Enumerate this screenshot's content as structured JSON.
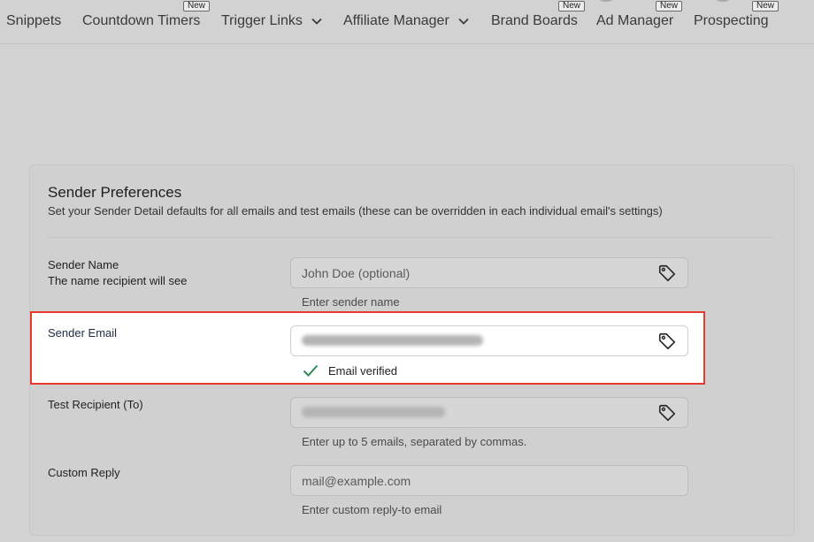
{
  "nav": {
    "items": [
      {
        "label": "Snippets"
      },
      {
        "label": "Countdown Timers",
        "badge": "New"
      },
      {
        "label": "Trigger Links"
      },
      {
        "label": "Affiliate Manager"
      },
      {
        "label": "Brand Boards",
        "badge": "New"
      },
      {
        "label": "Ad Manager",
        "badge": "New"
      },
      {
        "label": "Prospecting",
        "badge": "New"
      }
    ]
  },
  "sender_preferences": {
    "title": "Sender Preferences",
    "subtitle": "Set your Sender Detail defaults for all emails and test emails (these can be overridden in each individual email's settings)",
    "sender_name": {
      "label": "Sender Name",
      "description": "The name recipient will see",
      "placeholder": "John Doe (optional)",
      "helper": "Enter sender name"
    },
    "sender_email": {
      "label": "Sender Email",
      "status": "Email verified"
    },
    "test_recipient": {
      "label": "Test Recipient (To)",
      "helper": "Enter up to 5 emails, separated by commas."
    },
    "custom_reply": {
      "label": "Custom Reply",
      "placeholder": "mail@example.com",
      "helper": "Enter custom reply-to email"
    }
  },
  "colors": {
    "highlight": "#e8392e",
    "verified_check": "#2e8b57"
  }
}
